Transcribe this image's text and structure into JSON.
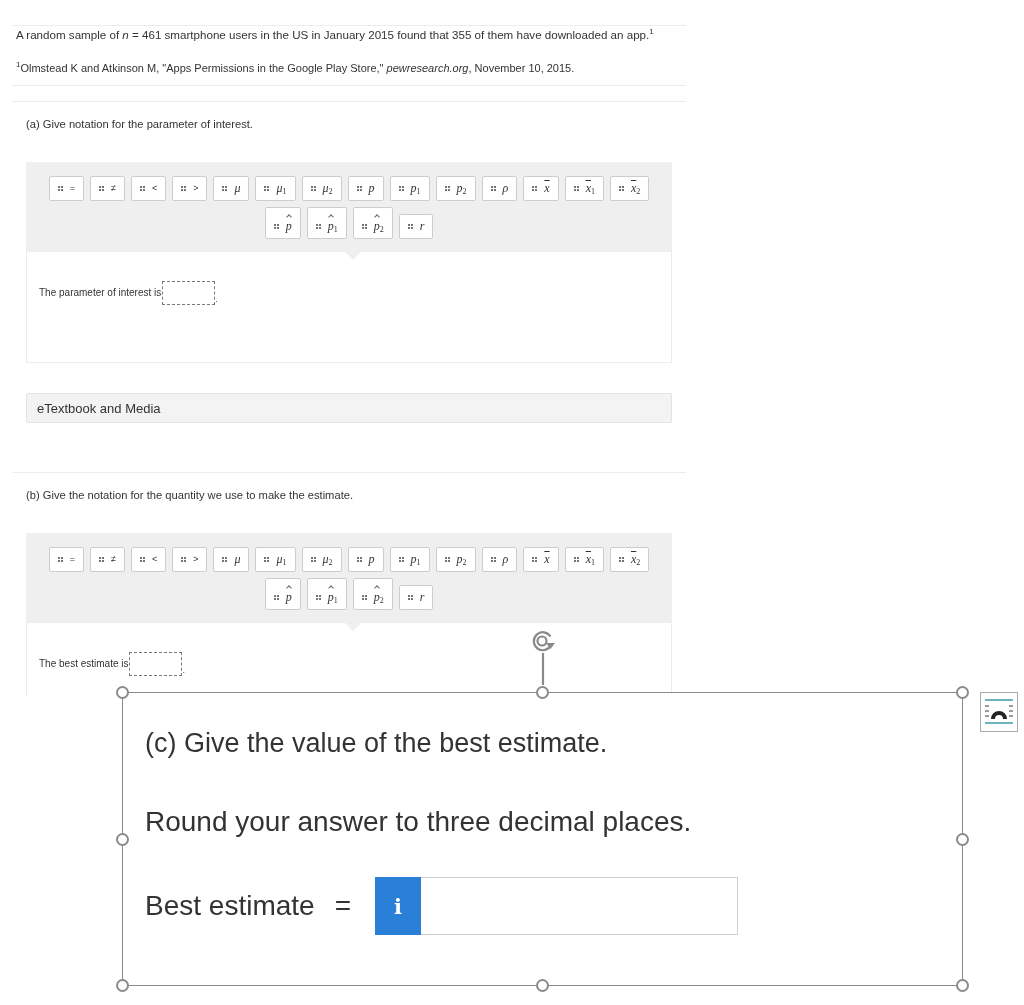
{
  "intro": {
    "text": "A random sample of *n* = 461 smartphone users in the US in January 2015 found that 355 of them have downloaded an app.$^{1}$",
    "footnote": "$^{1}$Olmstead K and Atkinson M, \"Apps Permissions in the Google Play Store,\" *pewresearch.org*, November 10, 2015."
  },
  "parts": [
    {
      "prompt": "(a) Give notation for the parameter of interest.",
      "palette": [
        {
          "kind": "relation",
          "label": "="
        },
        {
          "kind": "relation",
          "label": "≠"
        },
        {
          "kind": "relation",
          "label": "<"
        },
        {
          "kind": "relation",
          "label": ">"
        },
        {
          "kind": "plain",
          "label": "μ"
        },
        {
          "kind": "plain",
          "label": "μ$_{1}$"
        },
        {
          "kind": "plain",
          "label": "μ$_{2}$"
        },
        {
          "kind": "plain",
          "label": "p"
        },
        {
          "kind": "plain",
          "label": "p$_{1}$"
        },
        {
          "kind": "plain",
          "label": "p$_{2}$"
        },
        {
          "kind": "plain",
          "label": "ρ"
        },
        {
          "kind": "barred",
          "label": "x"
        },
        {
          "kind": "barred",
          "label": "x$_{1}$"
        },
        {
          "kind": "barred",
          "label": "x$_{2}$"
        },
        {
          "kind": "hatted",
          "label": "p"
        },
        {
          "kind": "hatted",
          "label": "p$_{1}$"
        },
        {
          "kind": "hatted",
          "label": "p$_{2}$"
        },
        {
          "kind": "plain",
          "label": "r"
        }
      ],
      "answer": {
        "label": "The parameter of interest is",
        "suffix": "."
      },
      "resources": "eTextbook and Media"
    },
    {
      "prompt": "(b) Give the notation for the quantity we use to make the estimate.",
      "palette": [
        {
          "kind": "relation",
          "label": "="
        },
        {
          "kind": "relation",
          "label": "≠"
        },
        {
          "kind": "relation",
          "label": "<"
        },
        {
          "kind": "relation",
          "label": ">"
        },
        {
          "kind": "plain",
          "label": "μ"
        },
        {
          "kind": "plain",
          "label": "μ$_{1}$"
        },
        {
          "kind": "plain",
          "label": "μ$_{2}$"
        },
        {
          "kind": "plain",
          "label": "p"
        },
        {
          "kind": "plain",
          "label": "p$_{1}$"
        },
        {
          "kind": "plain",
          "label": "p$_{2}$"
        },
        {
          "kind": "plain",
          "label": "ρ"
        },
        {
          "kind": "barred",
          "label": "x"
        },
        {
          "kind": "barred",
          "label": "x$_{1}$"
        },
        {
          "kind": "barred",
          "label": "x$_{2}$"
        },
        {
          "kind": "hatted",
          "label": "p"
        },
        {
          "kind": "hatted",
          "label": "p$_{1}$"
        },
        {
          "kind": "hatted",
          "label": "p$_{2}$"
        },
        {
          "kind": "plain",
          "label": "r"
        }
      ],
      "answer": {
        "label": "The best estimate is",
        "suffix": "."
      }
    }
  ],
  "pasted_image": {
    "selected": true,
    "title": "(c) Give the value of the best estimate.",
    "instruction": "Round your answer to three decimal places.",
    "answer_label": "Best estimate",
    "relation": "=",
    "info_button": "i"
  }
}
